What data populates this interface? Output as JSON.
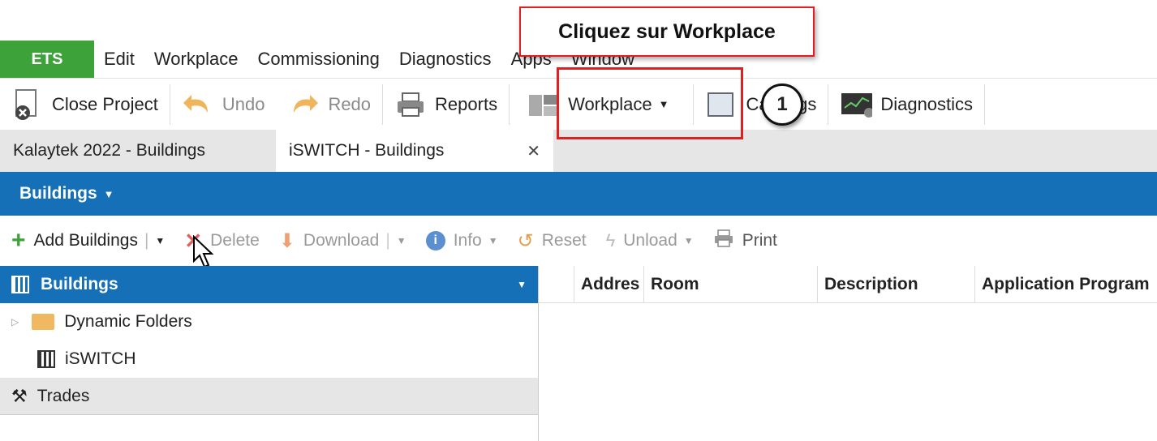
{
  "menubar": {
    "brand": "ETS",
    "items": [
      "Edit",
      "Workplace",
      "Commissioning",
      "Diagnostics",
      "Apps",
      "Window"
    ]
  },
  "toolbar": {
    "close_project": "Close Project",
    "undo": "Undo",
    "redo": "Redo",
    "reports": "Reports",
    "workplace": "Workplace",
    "catalogs": "Catalogs",
    "diagnostics": "Diagnostics"
  },
  "tabs": {
    "tab1": "Kalaytek 2022 - Buildings",
    "tab2": "iSWITCH - Buildings",
    "close_glyph": "✕"
  },
  "panel": {
    "title": "Buildings"
  },
  "actions": {
    "add": "Add Buildings",
    "delete": "Delete",
    "download": "Download",
    "info": "Info",
    "reset": "Reset",
    "unload": "Unload",
    "print": "Print"
  },
  "left_pane": {
    "header": "Buildings",
    "items": [
      "Dynamic Folders",
      "iSWITCH"
    ],
    "trades": "Trades"
  },
  "grid": {
    "columns": [
      "Addres",
      "Room",
      "Description",
      "Application Program"
    ]
  },
  "annotation": {
    "callout": "Cliquez sur Workplace",
    "step": "1"
  }
}
